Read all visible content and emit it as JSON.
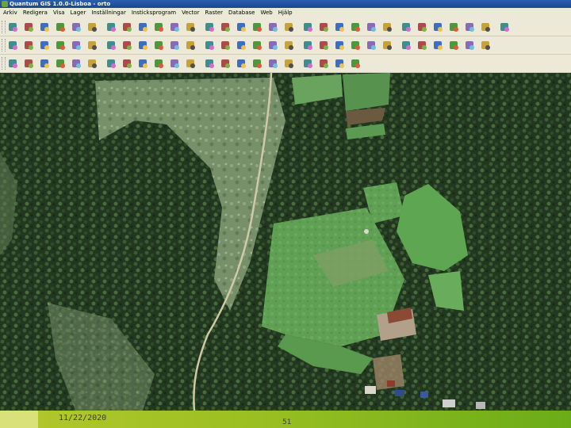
{
  "window": {
    "title": "Quantum GIS 1.0.0-Lisboa - orto"
  },
  "menu": {
    "items": [
      "Arkiv",
      "Redigera",
      "Visa",
      "Lager",
      "Inställningar",
      "Insticksprogram",
      "Vector",
      "Raster",
      "Database",
      "Web",
      "Hjälp"
    ]
  },
  "toolbars": {
    "row1": [
      "new-project",
      "open-project",
      "save-project",
      "save-as",
      "print-composer",
      "print",
      "add-vector-layer",
      "add-raster-layer",
      "add-postgis-layer",
      "add-spatialite-layer",
      "add-wms-layer",
      "new-shapefile",
      "layer-a",
      "layer-b",
      "layer-c",
      "layer-d",
      "layer-e",
      "layer-f",
      "layer-g",
      "layer-h",
      "layer-i",
      "layer-j",
      "layer-k",
      "capture-point",
      "capture-line",
      "capture-polygon",
      "move-feature",
      "delete-selected",
      "cut-features",
      "copy-features",
      "paste-features"
    ],
    "row2": [
      "digitize-a",
      "digitize-b",
      "digitize-c",
      "digitize-d",
      "digitize-e",
      "digitize-f",
      "digitize-g",
      "digitize-h",
      "digitize-i",
      "digitize-j",
      "digitize-k",
      "digitize-l",
      "digitize-m",
      "digitize-n",
      "digitize-o",
      "digitize-p",
      "digitize-q",
      "digitize-r",
      "digitize-s",
      "digitize-t",
      "digitize-u",
      "digitize-v",
      "digitize-w",
      "digitize-x",
      "digitize-y",
      "digitize-z",
      "digitize-aa",
      "digitize-ab",
      "digitize-ac",
      "digitize-ad"
    ],
    "row3": [
      "pan-map",
      "zoom-in",
      "zoom-out",
      "zoom-full",
      "zoom-selection",
      "zoom-layer",
      "zoom-last",
      "refresh",
      "identify",
      "select-features",
      "deselect",
      "open-attribute-table",
      "measure-line",
      "measure-area",
      "map-tips",
      "new-bookmark",
      "show-bookmarks",
      "plugin-a",
      "plugin-b",
      "plugin-c",
      "plugin-d",
      "help"
    ]
  },
  "slide": {
    "date": "11/22/2020",
    "page_number": "51"
  },
  "colors": {
    "footer_green": "#9abf22",
    "titlebar_blue": "#1b4690",
    "toolbar_bg": "#ece9d8"
  }
}
